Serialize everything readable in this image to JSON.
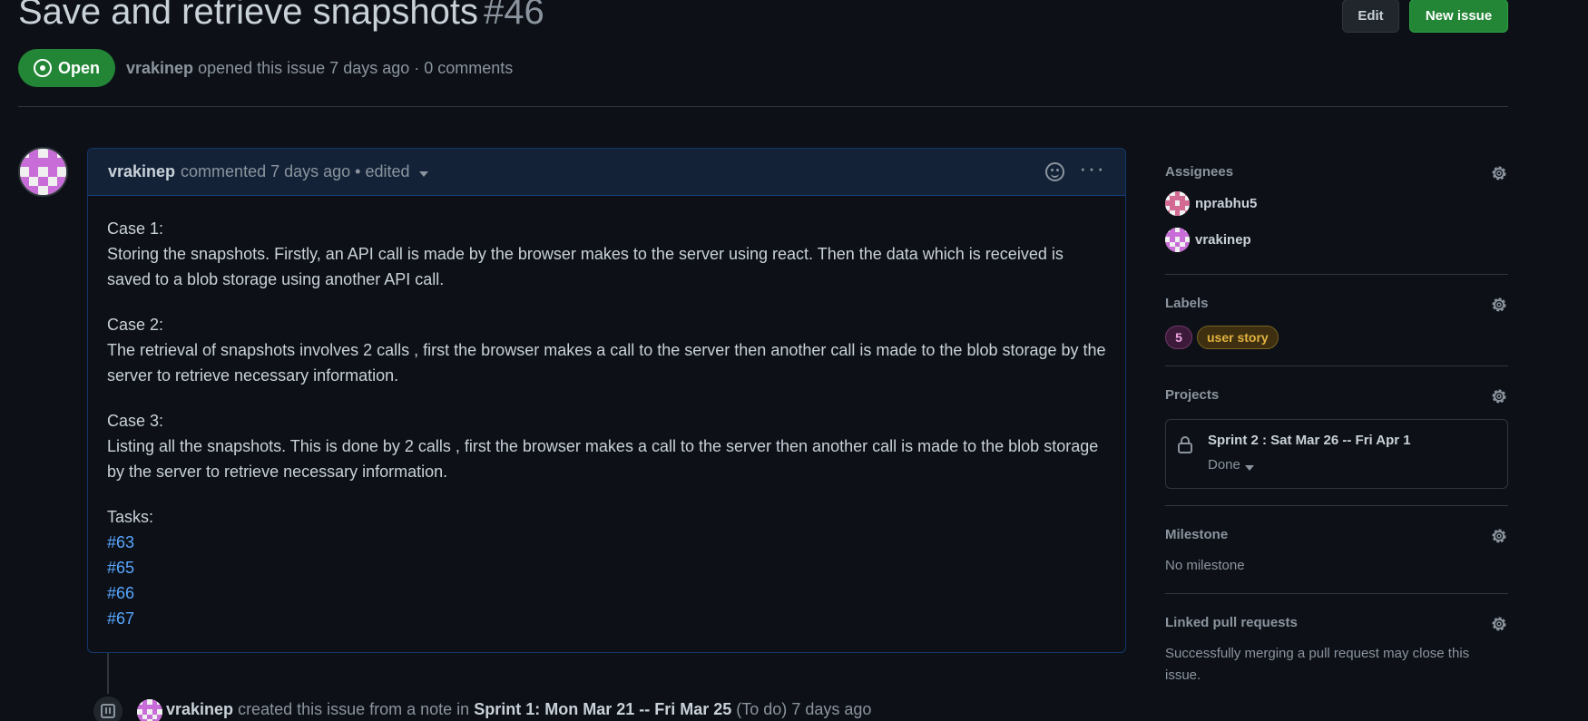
{
  "issue": {
    "title": "Save and retrieve snapshots",
    "number": "#46",
    "state": "Open",
    "author": "vrakinep",
    "opened_text": "opened this issue 7 days ago · 0 comments",
    "edit_label": "Edit",
    "new_issue_label": "New issue"
  },
  "comment": {
    "author": "vrakinep",
    "meta": "commented 7 days ago • edited",
    "paragraphs": [
      {
        "heading": "Case 1:",
        "text": "Storing the snapshots. Firstly, an API call is made by the browser makes to the server using react. Then the data which is received is saved to a blob storage using another API call."
      },
      {
        "heading": "Case 2:",
        "text": "The retrieval of snapshots involves 2 calls , first the browser makes a call to the server then another call is made to the blob storage by the server to retrieve necessary information."
      },
      {
        "heading": "Case 3:",
        "text": "Listing all the snapshots. This is done by 2 calls , first the browser makes a call to the server then another call is made to the blob storage by the server to retrieve necessary information."
      }
    ],
    "tasks_heading": "Tasks:",
    "tasks": [
      "#63",
      "#65",
      "#66",
      "#67"
    ]
  },
  "timeline": {
    "author": "vrakinep",
    "pre": "created this issue from a note in",
    "project": "Sprint 1: Mon Mar 21 -- Fri Mar 25",
    "column": "(To do)",
    "time": "7 days ago"
  },
  "sidebar": {
    "assignees": {
      "title": "Assignees",
      "users": [
        "nprabhu5",
        "vrakinep"
      ]
    },
    "labels": {
      "title": "Labels",
      "items": [
        "5",
        "user story"
      ]
    },
    "projects": {
      "title": "Projects",
      "name": "Sprint 2 : Sat Mar 26 -- Fri Apr 1",
      "status": "Done"
    },
    "milestone": {
      "title": "Milestone",
      "value": "No milestone"
    },
    "linked_prs": {
      "title": "Linked pull requests",
      "text": "Successfully merging a pull request may close this issue."
    }
  },
  "colors": {
    "background": "#0d1117",
    "open_green": "#238636",
    "link_blue": "#58a6ff",
    "comment_header": "#132237"
  }
}
